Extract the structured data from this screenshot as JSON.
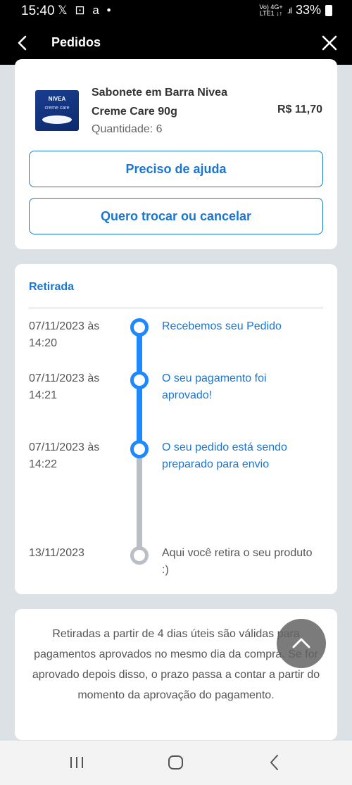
{
  "status_bar": {
    "time": "15:40",
    "notification_icons": "𝕏 ⊡ a •",
    "network": "Vo) 4G+\nLTE1 ↓↑",
    "signal": ".ıl",
    "battery": "33%"
  },
  "app_bar": {
    "title": "Pedidos"
  },
  "product": {
    "image_brand": "NIVEA",
    "image_sub": "creme care",
    "name": "Sabonete em Barra Nivea Creme Care 90g",
    "price": "R$ 11,70",
    "quantity": "Quantidade: 6"
  },
  "actions": {
    "help": "Preciso de ajuda",
    "exchange": "Quero trocar ou cancelar"
  },
  "pickup": {
    "title": "Retirada",
    "timeline": [
      {
        "date": "07/11/2023 às 14:20",
        "text": "Recebemos seu Pedido",
        "done": true
      },
      {
        "date": "07/11/2023 às 14:21",
        "text": "O seu pagamento foi aprovado!",
        "done": true
      },
      {
        "date": "07/11/2023 às 14:22",
        "text": "O seu pedido está sendo preparado para envio",
        "done": true
      },
      {
        "date": "13/11/2023",
        "text": "Aqui você retira o seu produto :)",
        "done": false
      }
    ]
  },
  "info": {
    "text": "Retiradas a partir de 4 dias úteis são válidas para pagamentos aprovados no mesmo dia da compra. Se for aprovado depois disso, o prazo passa a contar a partir do momento da aprovação do pagamento."
  },
  "colors": {
    "accent": "#1976d2",
    "timeline_done": "#1e88ff",
    "timeline_pending": "#b9bfc4",
    "background": "#dce1e6"
  },
  "icons": {
    "back": "chevron-left-icon",
    "close": "close-icon",
    "scroll_top": "chevron-up-icon",
    "nav_recents": "recents-icon",
    "nav_home": "home-icon",
    "nav_back": "back-icon"
  }
}
